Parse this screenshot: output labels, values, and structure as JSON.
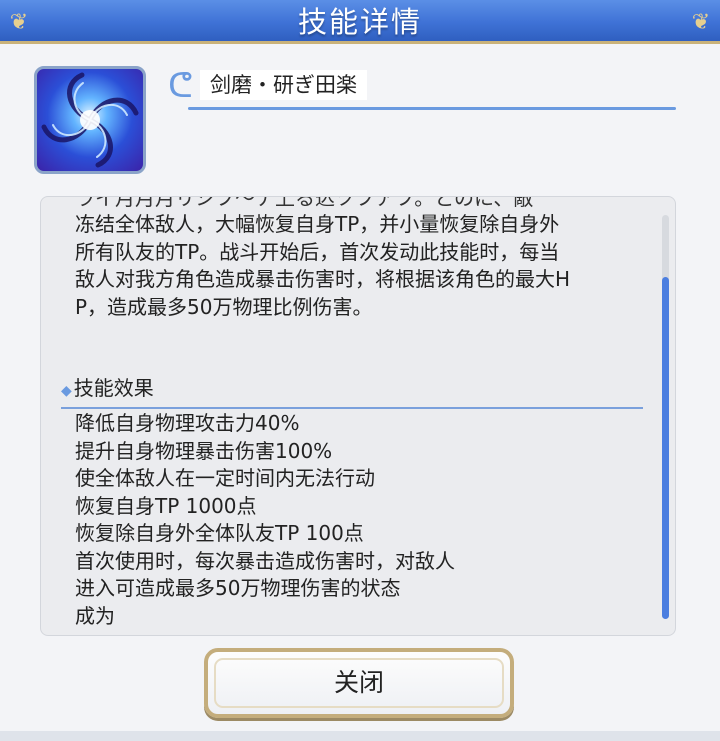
{
  "header": {
    "title": "技能详情"
  },
  "skill": {
    "icon": "swirl-skill-icon",
    "name": "剑磨・研ぎ田楽"
  },
  "description": {
    "cutoff_line": "ライ月月月リシフ〜ナ上る込ツフアフ。とのに、敵",
    "lines": [
      "冻结全体敌人，大幅恢复自身TP，并小量恢复除自身外",
      "所有队友的TP。战斗开始后，首次发动此技能时，每当",
      "敌人对我方角色造成暴击伤害时，将根据该角色的最大H",
      "P，造成最多50万物理比例伤害。"
    ]
  },
  "effects": {
    "header": "技能效果",
    "items": [
      "降低自身物理攻击力40%",
      "提升自身物理暴击伤害100%",
      "使全体敌人在一定时间内无法行动",
      "恢复自身TP 1000点",
      "恢复除自身外全体队友TP 100点",
      "首次使用时，每次暴击造成伤害时，对敌人",
      "进入可造成最多50万物理伤害的状态",
      "成为"
    ]
  },
  "buttons": {
    "close_label": "关闭"
  },
  "colors": {
    "header_blue": "#3f72d6",
    "accent_blue": "#6a9ae0",
    "gold_border": "#c4ad7c",
    "scroll_thumb": "#4b7ee0"
  }
}
